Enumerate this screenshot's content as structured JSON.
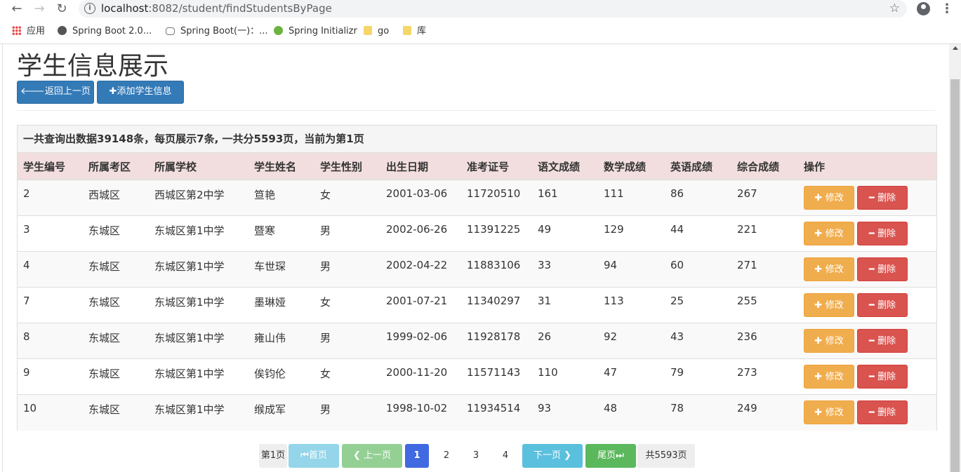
{
  "browser": {
    "url_host": "localhost",
    "url_path": ":8082/student/findStudentsByPage",
    "bookmarks": [
      {
        "label": "应用",
        "icon": "apps-grid-icon"
      },
      {
        "label": "Spring Boot 2.0...",
        "icon": "globe-icon"
      },
      {
        "label": "Spring Boot(一)：...",
        "icon": "cloud-icon"
      },
      {
        "label": "Spring Initializr",
        "icon": "spring-icon"
      },
      {
        "label": "go",
        "icon": "folder-icon"
      },
      {
        "label": "库",
        "icon": "folder-icon"
      }
    ]
  },
  "page": {
    "title": "学生信息展示",
    "back_label": "返回上一页",
    "add_label": "添加学生信息"
  },
  "panel": {
    "summary": "一共查询出数据39148条，每页展示7条, 一共分5593页，当前为第1页"
  },
  "table": {
    "headers": [
      "学生编号",
      "所属考区",
      "所属学校",
      "学生姓名",
      "学生性别",
      "出生日期",
      "准考证号",
      "语文成绩",
      "数学成绩",
      "英语成绩",
      "综合成绩",
      "操作"
    ],
    "rows": [
      [
        "2",
        "西城区",
        "西城区第2中学",
        "笪艳",
        "女",
        "2001-03-06",
        "11720510",
        "161",
        "111",
        "86",
        "267"
      ],
      [
        "3",
        "东城区",
        "东城区第1中学",
        "暨寒",
        "男",
        "2002-06-26",
        "11391225",
        "49",
        "129",
        "44",
        "221"
      ],
      [
        "4",
        "东城区",
        "东城区第1中学",
        "车世琛",
        "男",
        "2002-04-22",
        "11883106",
        "33",
        "94",
        "60",
        "271"
      ],
      [
        "7",
        "东城区",
        "东城区第1中学",
        "墨琳娅",
        "女",
        "2001-07-21",
        "11340297",
        "31",
        "113",
        "25",
        "255"
      ],
      [
        "8",
        "东城区",
        "东城区第1中学",
        "雍山伟",
        "男",
        "1999-02-06",
        "11928178",
        "26",
        "92",
        "43",
        "236"
      ],
      [
        "9",
        "东城区",
        "东城区第1中学",
        "俟钧伦",
        "女",
        "2000-11-20",
        "11571143",
        "110",
        "47",
        "79",
        "273"
      ],
      [
        "10",
        "东城区",
        "东城区第1中学",
        "缑成军",
        "男",
        "1998-10-02",
        "11934514",
        "93",
        "48",
        "78",
        "249"
      ]
    ],
    "edit_label": "修改",
    "delete_label": "删除"
  },
  "pagination": {
    "current_text": "第1页",
    "first_label": "首页",
    "prev_label": "上一页",
    "pages": [
      "1",
      "2",
      "3",
      "4"
    ],
    "active_page": "1",
    "next_label": "下一页",
    "last_label": "尾页",
    "total_text": "共5593页"
  }
}
